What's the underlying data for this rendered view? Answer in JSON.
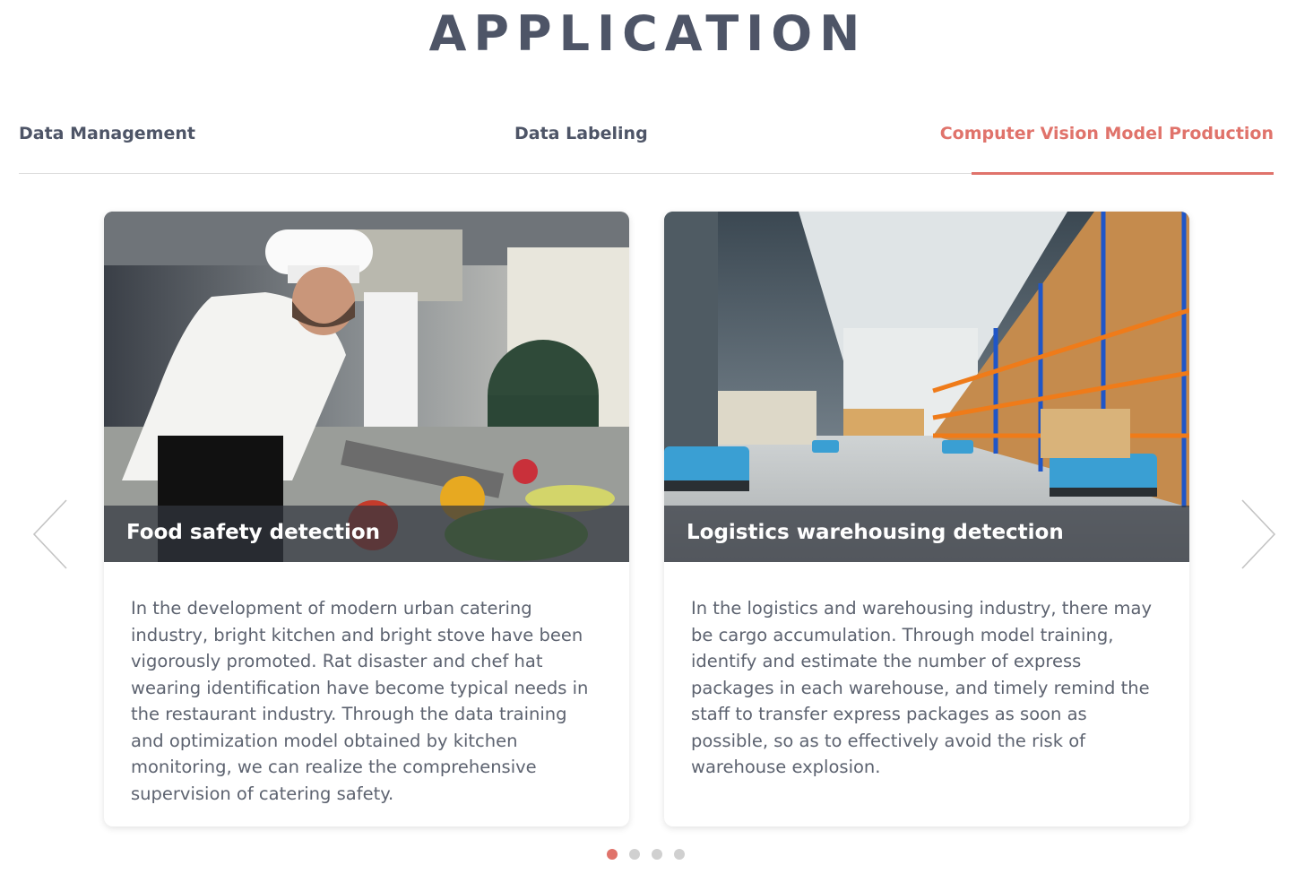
{
  "section": {
    "title": "APPLICATION"
  },
  "tabs": [
    {
      "label": "Data Management",
      "active": false
    },
    {
      "label": "Data Labeling",
      "active": false
    },
    {
      "label": "Computer Vision Model Production",
      "active": true
    }
  ],
  "accent_color": "#e0736b",
  "text_color": "#4e5567",
  "carousel": {
    "prev_icon": "chevron-left-icon",
    "next_icon": "chevron-right-icon",
    "cards": [
      {
        "title": "Food safety detection",
        "image": "chef-in-kitchen-photo",
        "description": "In the development of modern urban catering industry, bright kitchen and bright stove have been vigorously promoted. Rat disaster and chef hat wearing identification have become typical needs in the restaurant industry. Through the data training and optimization model obtained by kitchen monitoring, we can realize the comprehensive supervision of catering safety."
      },
      {
        "title": "Logistics warehousing detection",
        "image": "warehouse-robots-photo",
        "description": "In the logistics and warehousing industry, there may be cargo accumulation. Through model training, identify and estimate the number of express packages in each warehouse, and timely remind the staff to transfer express packages as soon as possible, so as to effectively avoid the risk of warehouse explosion."
      }
    ],
    "page_count": 4,
    "active_page": 1
  }
}
